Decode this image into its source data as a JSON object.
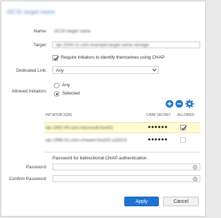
{
  "dialog": {
    "title": "iSCSI target name"
  },
  "form": {
    "name_label": "Name:",
    "name_value": "iSCSI target name",
    "target_label": "Target:",
    "target_value": "iqn.2004-11.com.example:target.name-storage",
    "require_chap_label": "Require initiators to identify themselves using CHAP",
    "require_chap_checked": true,
    "dedicated_link_label": "Dedicated Link:",
    "dedicated_link_value": "Any",
    "allowed_initiators_label": "Allowed Initiators:",
    "radio_any_label": "Any",
    "radio_selected_label": "Selected",
    "selected_option": "Selected"
  },
  "table": {
    "col_initiator": "INITIATOR (IQN)",
    "col_secret": "CHAP SECRET",
    "col_allowed": "ALLOWED",
    "rows": [
      {
        "iqn": "iqn.1991-05.com.microsoft:host01",
        "secret": "●●●●●●",
        "allowed": true,
        "highlighted": true
      },
      {
        "iqn": "iqn.1998-01.com.vmware:host02-a1b2c3",
        "secret": "●●●●●●",
        "allowed": false,
        "highlighted": false
      }
    ]
  },
  "bidirectional": {
    "caption": "Password for bidirectional CHAP authentication",
    "password_label": "Password:",
    "confirm_label": "Confirm Password:"
  },
  "buttons": {
    "apply": "Apply",
    "cancel": "Cancel"
  },
  "colors": {
    "accent": "#1f73d6",
    "highlight_row": "#fffbd2"
  }
}
